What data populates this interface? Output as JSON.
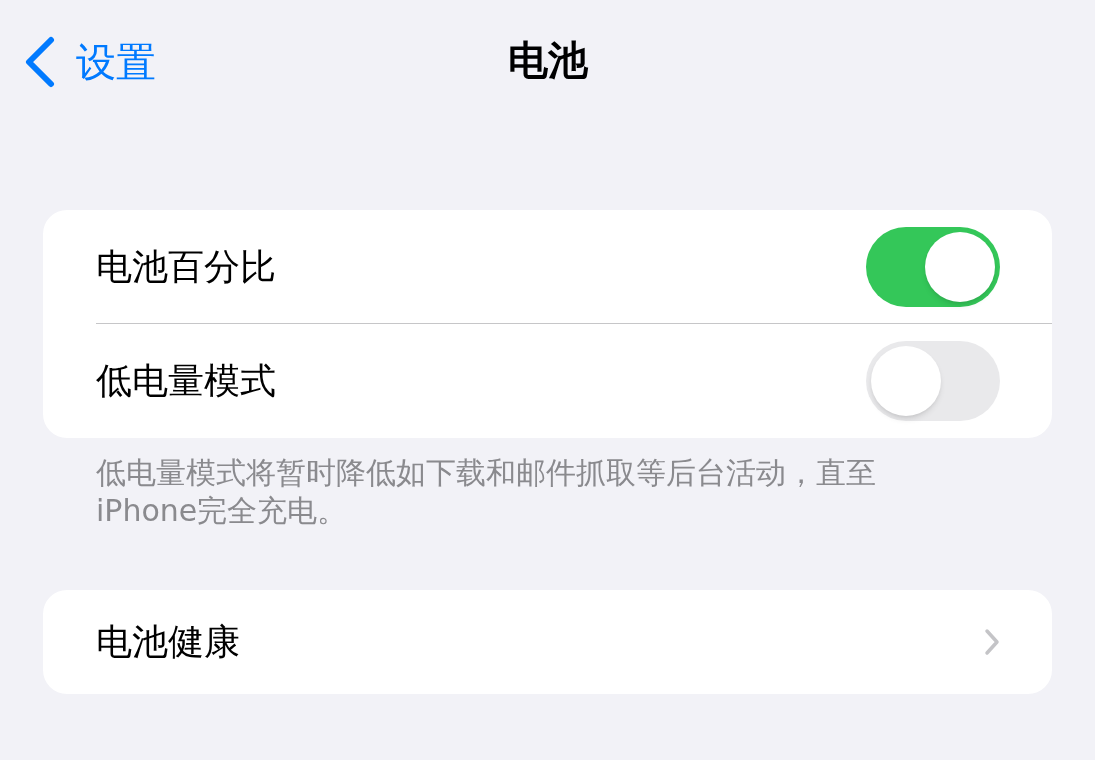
{
  "nav": {
    "back_label": "设置",
    "title": "电池"
  },
  "groups": [
    {
      "rows": [
        {
          "kind": "toggle",
          "label": "电池百分比",
          "on": true
        },
        {
          "kind": "toggle",
          "label": "低电量模式",
          "on": false
        }
      ],
      "footer": "低电量模式将暂时降低如下载和邮件抓取等后台活动，直至iPhone完全充电。"
    },
    {
      "rows": [
        {
          "kind": "link",
          "label": "电池健康"
        }
      ]
    }
  ]
}
